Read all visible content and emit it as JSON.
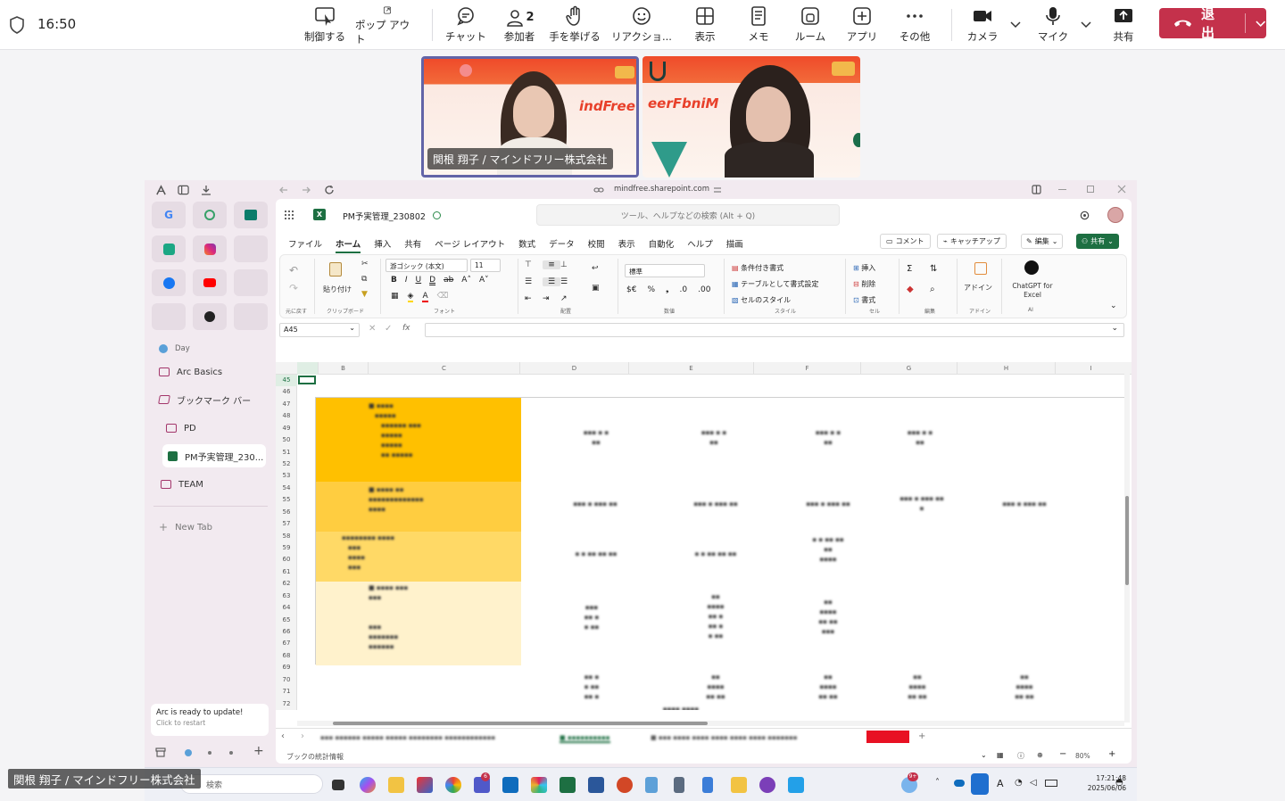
{
  "teams": {
    "time": "16:50",
    "toolbar": [
      {
        "id": "control",
        "label": "制御する",
        "icon": "cursor-share-icon"
      },
      {
        "id": "popout",
        "label": "ポップ アウト",
        "icon": "popout-icon"
      },
      {
        "id": "chat",
        "label": "チャット",
        "icon": "chat-icon"
      },
      {
        "id": "people",
        "label": "参加者",
        "icon": "people-icon",
        "count": "2"
      },
      {
        "id": "raise",
        "label": "手を挙げる",
        "icon": "raise-hand-icon"
      },
      {
        "id": "react",
        "label": "リアクショ...",
        "icon": "emoji-icon"
      },
      {
        "id": "view",
        "label": "表示",
        "icon": "grid-view-icon"
      },
      {
        "id": "notes",
        "label": "メモ",
        "icon": "notes-icon"
      },
      {
        "id": "rooms",
        "label": "ルーム",
        "icon": "rooms-icon"
      },
      {
        "id": "apps",
        "label": "アプリ",
        "icon": "add-app-icon"
      },
      {
        "id": "more",
        "label": "その他",
        "icon": "more-icon"
      },
      {
        "id": "camera",
        "label": "カメラ",
        "icon": "camera-icon"
      },
      {
        "id": "mic",
        "label": "マイク",
        "icon": "mic-icon"
      },
      {
        "id": "share",
        "label": "共有",
        "icon": "share-icon"
      }
    ],
    "leave_label": "退出",
    "accent": "#c4314b",
    "tiles": [
      {
        "name": "関根 翔子 / マインドフリー株式会社",
        "logo": "indFree"
      },
      {
        "logo": "eerFbniM"
      }
    ],
    "presenter_overlay": "関根 翔子 / マインドフリー株式会社"
  },
  "browser": {
    "url": "mindfree.sharepoint.com",
    "sidebar": {
      "items": [
        {
          "label": "Day",
          "icon": "day-icon"
        },
        {
          "label": "Arc Basics",
          "icon": "folder-icon"
        },
        {
          "label": "ブックマーク バー",
          "icon": "folder-open-icon"
        },
        {
          "label": "PD",
          "icon": "folder-icon"
        },
        {
          "label": "PM予実管理_230...",
          "icon": "excel-icon"
        },
        {
          "label": "TEAM",
          "icon": "folder-icon"
        }
      ],
      "new_tab": "New Tab",
      "update_title": "Arc is ready to update!",
      "update_sub": "Click to restart"
    }
  },
  "excel": {
    "file_name": "PM予実管理_230802",
    "search_placeholder": "ツール、ヘルプなどの検索 (Alt + Q)",
    "menu": [
      "ファイル",
      "ホーム",
      "挿入",
      "共有",
      "ページ レイアウト",
      "数式",
      "データ",
      "校閲",
      "表示",
      "自動化",
      "ヘルプ",
      "描画"
    ],
    "active_menu": "ホーム",
    "actions": {
      "comment": "コメント",
      "catchup": "キャッチアップ",
      "edit": "編集",
      "share": "共有"
    },
    "ribbon": {
      "undo": "元に戻す",
      "paste": "貼り付け",
      "clipboard": "クリップボード",
      "font_name": "游ゴシック (本文)",
      "font_size": "11",
      "font": "フォント",
      "align": "配置",
      "number_format": "標準",
      "number": "数値",
      "cond_format": "条件付き書式",
      "table_format": "テーブルとして書式設定",
      "cell_style": "セルのスタイル",
      "style": "スタイル",
      "insert": "挿入",
      "delete": "削除",
      "format": "書式",
      "cells": "セル",
      "edit_grp": "編集",
      "addin": "アドイン",
      "addin_grp": "アドイン",
      "chatgpt": "ChatGPT for Excel",
      "ai": "AI"
    },
    "name_box": "A45",
    "columns": [
      "B",
      "C",
      "D",
      "E",
      "F",
      "G",
      "H",
      "I"
    ],
    "rows": [
      "45",
      "46",
      "47",
      "48",
      "49",
      "50",
      "51",
      "52",
      "53",
      "54",
      "55",
      "56",
      "57",
      "58",
      "59",
      "60",
      "61",
      "62",
      "63",
      "64",
      "65",
      "66",
      "67",
      "68",
      "69",
      "70",
      "71",
      "72"
    ],
    "status_left": "ブックの統計情報",
    "zoom": "80%"
  },
  "taskbar": {
    "search_placeholder": "検索",
    "time": "17:21:48",
    "date": "2025/06/06",
    "input_mode": "A",
    "badges": {
      "teams": "6",
      "weather": "9+"
    }
  }
}
